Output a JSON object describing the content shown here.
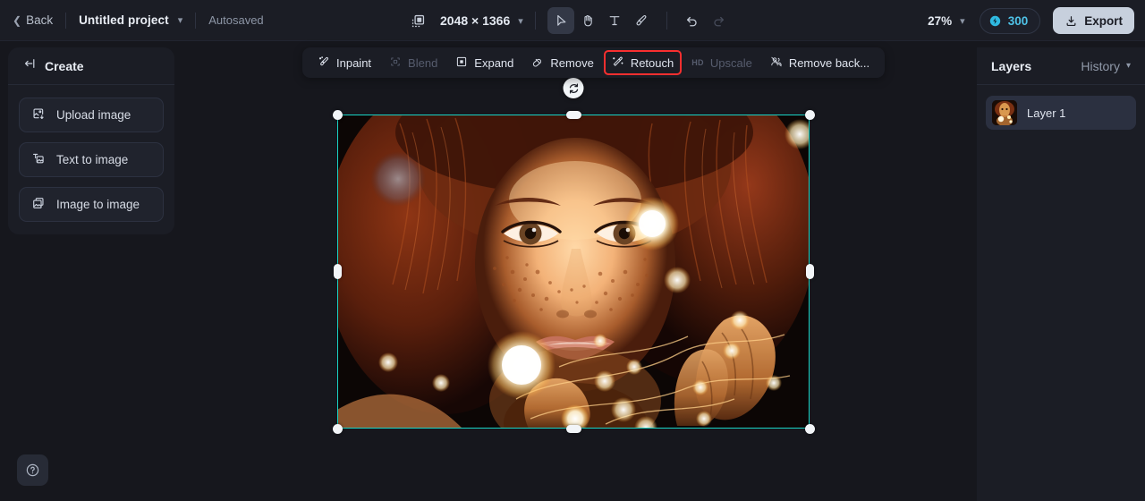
{
  "topbar": {
    "back_label": "Back",
    "back_icon": "chevron-left-icon",
    "project_name": "Untitled project",
    "project_chevron_icon": "chevron-down-icon",
    "autosaved_label": "Autosaved",
    "canvas_size_icon": "canvas-resize-icon",
    "dimensions": "2048 × 1366",
    "dimensions_chevron_icon": "chevron-down-icon",
    "tools": [
      {
        "name": "select-tool",
        "icon": "cursor-arrow-icon",
        "active": true,
        "disabled": false
      },
      {
        "name": "hand-tool",
        "icon": "hand-icon",
        "active": false,
        "disabled": false
      },
      {
        "name": "text-tool",
        "icon": "text-t-icon",
        "active": false,
        "disabled": false
      },
      {
        "name": "brush-tool",
        "icon": "brush-icon",
        "active": false,
        "disabled": false
      }
    ],
    "undo_icon": "undo-arrow-icon",
    "redo_icon": "redo-arrow-icon",
    "redo_disabled": true,
    "zoom_level": "27%",
    "zoom_chevron_icon": "chevron-down-icon",
    "credits_icon": "credit-coin-icon",
    "credits_value": "300",
    "export_icon": "download-icon",
    "export_label": "Export"
  },
  "left_panel": {
    "collapse_icon": "collapse-panel-icon",
    "title": "Create",
    "items": [
      {
        "label": "Upload image",
        "icon": "upload-image-icon"
      },
      {
        "label": "Text to image",
        "icon": "text-to-image-icon"
      },
      {
        "label": "Image to image",
        "icon": "image-to-image-icon"
      }
    ]
  },
  "float_toolbar": {
    "items": [
      {
        "label": "Inpaint",
        "icon": "inpaint-brush-icon",
        "disabled": false,
        "highlighted": false
      },
      {
        "label": "Blend",
        "icon": "blend-icon",
        "disabled": true,
        "highlighted": false
      },
      {
        "label": "Expand",
        "icon": "expand-icon",
        "disabled": false,
        "highlighted": false
      },
      {
        "label": "Remove",
        "icon": "eraser-icon",
        "disabled": false,
        "highlighted": false
      },
      {
        "label": "Retouch",
        "icon": "magic-wand-icon",
        "disabled": false,
        "highlighted": true
      },
      {
        "label": "Upscale",
        "icon": "hd-badge-icon",
        "disabled": true,
        "highlighted": false
      },
      {
        "label": "Remove back...",
        "icon": "remove-background-icon",
        "disabled": false,
        "highlighted": false
      }
    ],
    "highlight_color": "#fa2f2f"
  },
  "right_panel": {
    "layers_tab": "Layers",
    "history_tab": "History",
    "history_chevron_icon": "chevron-down-icon",
    "layers": [
      {
        "label": "Layer 1",
        "thumbnail": "portrait-fairy-lights-thumb"
      }
    ]
  },
  "canvas": {
    "image_alt": "portrait of red-haired woman with freckles holding fairy lights",
    "selection_color": "#19d3c5",
    "rotate_handle_icon": "rotate-icon",
    "handles": [
      "top-left",
      "top-center",
      "top-right",
      "middle-left",
      "middle-right",
      "bottom-left",
      "bottom-center",
      "bottom-right"
    ]
  },
  "help": {
    "icon": "question-mark-circle-icon"
  }
}
